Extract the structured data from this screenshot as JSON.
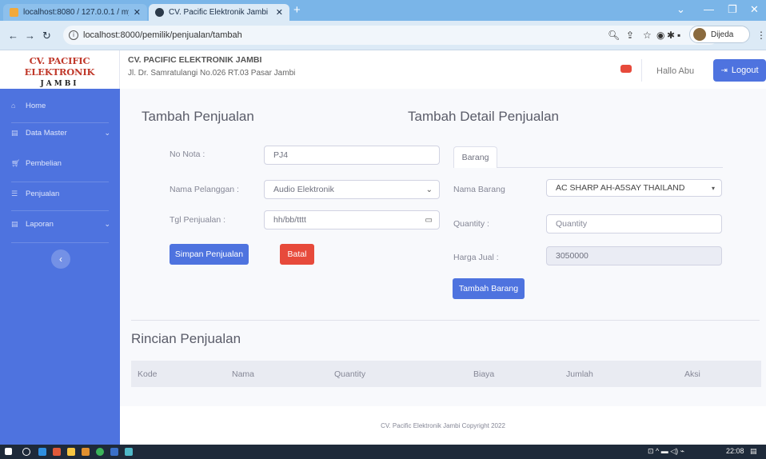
{
  "browser": {
    "tabs": [
      {
        "title": "localhost:8080 / 127.0.0.1 / mysq"
      },
      {
        "title": "CV. Pacific Elektronik Jambi"
      }
    ],
    "url": "localhost:8000/pemilik/penjualan/tambah",
    "profile_name": "Dijeda"
  },
  "brand": {
    "line1": "CV. PACIFIC ELEKTRONIK",
    "line2": "JAMBI"
  },
  "header": {
    "company_name": "CV. PACIFIC ELEKTRONIK JAMBI",
    "company_address": "Jl. Dr. Samratulangi No.026 RT.03 Pasar Jambi",
    "greeting": "Hallo Abu",
    "logout_label": "Logout"
  },
  "sidebar": {
    "items": [
      {
        "label": "Home"
      },
      {
        "label": "Data Master"
      },
      {
        "label": "Pembelian"
      },
      {
        "label": "Penjualan"
      },
      {
        "label": "Laporan"
      }
    ]
  },
  "form_penjualan": {
    "title": "Tambah Penjualan",
    "no_nota_label": "No Nota :",
    "no_nota_value": "PJ4",
    "pelanggan_label": "Nama Pelanggan :",
    "pelanggan_value": "Audio Elektronik",
    "tgl_label": "Tgl Penjualan :",
    "tgl_value": "hh/bb/tttt",
    "simpan_label": "Simpan Penjualan",
    "batal_label": "Batal"
  },
  "form_detail": {
    "title": "Tambah Detail Penjualan",
    "tab_label": "Barang",
    "barang_label": "Nama Barang",
    "barang_value": "AC SHARP AH-A5SAY THAILAND",
    "qty_label": "Quantity :",
    "qty_placeholder": "Quantity",
    "harga_label": "Harga Jual :",
    "harga_value": "3050000",
    "tambah_label": "Tambah Barang"
  },
  "rincian": {
    "title": "Rincian Penjualan",
    "columns": [
      "Kode",
      "Nama",
      "Quantity",
      "Biaya",
      "Jumlah",
      "Aksi"
    ]
  },
  "footer": {
    "text": "CV. Pacific Elektronik Jambi Copyright 2022"
  },
  "taskbar": {
    "time": "22:08"
  }
}
